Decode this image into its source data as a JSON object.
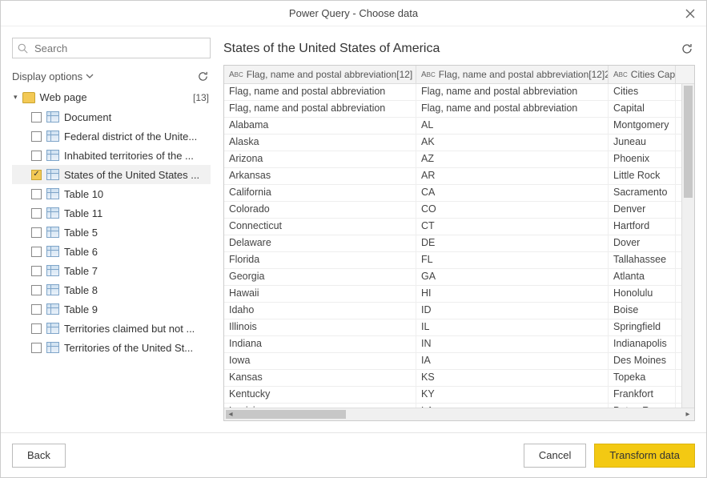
{
  "titlebar": {
    "title": "Power Query - Choose data"
  },
  "sidebar": {
    "search_placeholder": "Search",
    "display_options_label": "Display options",
    "tree": {
      "root_label": "Web page",
      "count": "[13]",
      "items": [
        {
          "label": "Document",
          "checked": false
        },
        {
          "label": "Federal district of the Unite...",
          "checked": false
        },
        {
          "label": "Inhabited territories of the ...",
          "checked": false
        },
        {
          "label": "States of the United States ...",
          "checked": true
        },
        {
          "label": "Table 10",
          "checked": false
        },
        {
          "label": "Table 11",
          "checked": false
        },
        {
          "label": "Table 5",
          "checked": false
        },
        {
          "label": "Table 6",
          "checked": false
        },
        {
          "label": "Table 7",
          "checked": false
        },
        {
          "label": "Table 8",
          "checked": false
        },
        {
          "label": "Table 9",
          "checked": false
        },
        {
          "label": "Territories claimed but not ...",
          "checked": false
        },
        {
          "label": "Territories of the United St...",
          "checked": false
        }
      ]
    }
  },
  "main": {
    "title": "States of the United States of America",
    "columns": [
      "Flag, name and postal abbreviation[12]",
      "Flag, name and postal abbreviation[12]2",
      "Cities Capital"
    ],
    "rows": [
      [
        "Flag, name and postal abbreviation",
        "Flag, name and postal abbreviation",
        "Cities"
      ],
      [
        "Flag, name and postal abbreviation",
        "Flag, name and postal abbreviation",
        "Capital"
      ],
      [
        "Alabama",
        "AL",
        "Montgomery"
      ],
      [
        "Alaska",
        "AK",
        "Juneau"
      ],
      [
        "Arizona",
        "AZ",
        "Phoenix"
      ],
      [
        "Arkansas",
        "AR",
        "Little Rock"
      ],
      [
        "California",
        "CA",
        "Sacramento"
      ],
      [
        "Colorado",
        "CO",
        "Denver"
      ],
      [
        "Connecticut",
        "CT",
        "Hartford"
      ],
      [
        "Delaware",
        "DE",
        "Dover"
      ],
      [
        "Florida",
        "FL",
        "Tallahassee"
      ],
      [
        "Georgia",
        "GA",
        "Atlanta"
      ],
      [
        "Hawaii",
        "HI",
        "Honolulu"
      ],
      [
        "Idaho",
        "ID",
        "Boise"
      ],
      [
        "Illinois",
        "IL",
        "Springfield"
      ],
      [
        "Indiana",
        "IN",
        "Indianapolis"
      ],
      [
        "Iowa",
        "IA",
        "Des Moines"
      ],
      [
        "Kansas",
        "KS",
        "Topeka"
      ],
      [
        "Kentucky",
        "KY",
        "Frankfort"
      ],
      [
        "Louisiana",
        "LA",
        "Baton Rouge"
      ]
    ]
  },
  "footer": {
    "back": "Back",
    "cancel": "Cancel",
    "transform": "Transform data"
  }
}
